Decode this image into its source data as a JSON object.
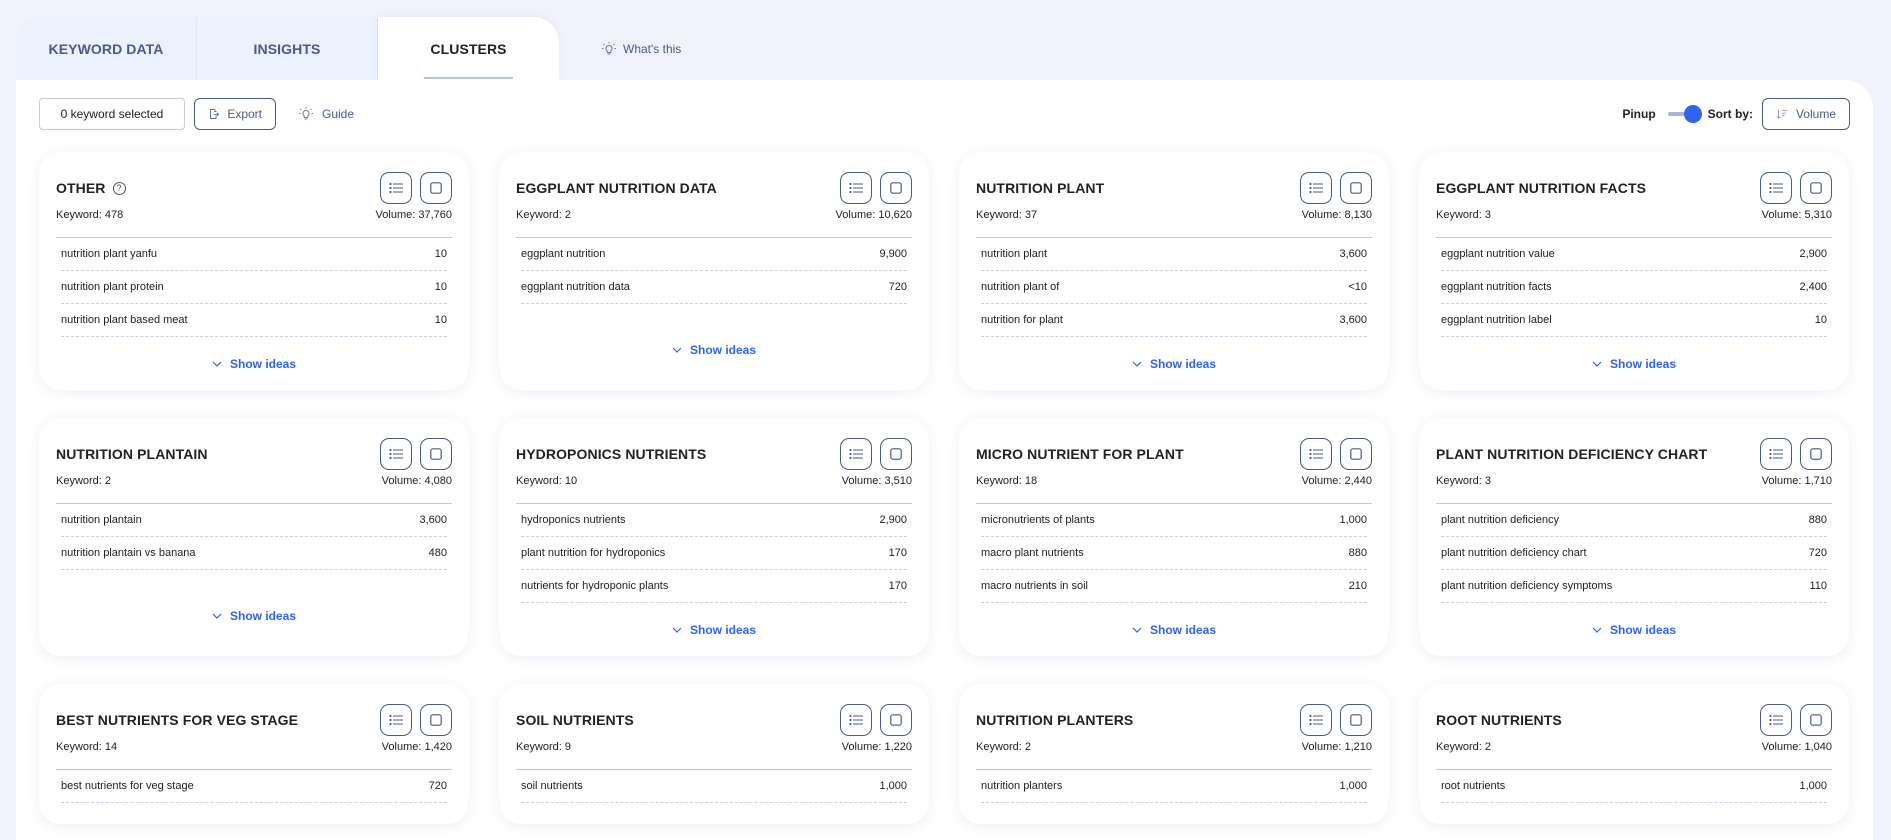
{
  "tabs": [
    {
      "label": "KEYWORD DATA",
      "active": false
    },
    {
      "label": "INSIGHTS",
      "active": false
    },
    {
      "label": "CLUSTERS",
      "active": true
    }
  ],
  "whats_this": {
    "label": "What's this",
    "icon": "lightbulb-icon"
  },
  "toolbar": {
    "selected_label": "0 keyword selected",
    "export_label": "Export",
    "guide_label": "Guide",
    "pinup_label": "Pinup",
    "pinup_on": true,
    "sortby_label": "Sort by:",
    "sort_value": "Volume"
  },
  "colors": {
    "accent": "#2f64f0",
    "outline": "#4a5a8c",
    "background": "#f1f2fc"
  },
  "clusters": [
    {
      "title": "OTHER",
      "has_help": true,
      "keyword_label": "Keyword: 478",
      "volume_label": "Volume: 37,760",
      "rows": [
        {
          "keyword": "nutrition plant yanfu",
          "volume": "10"
        },
        {
          "keyword": "nutrition plant protein",
          "volume": "10"
        },
        {
          "keyword": "nutrition plant based meat",
          "volume": "10"
        }
      ],
      "show_ideas": "Show ideas"
    },
    {
      "title": "EGGPLANT NUTRITION DATA",
      "keyword_label": "Keyword: 2",
      "volume_label": "Volume: 10,620",
      "rows": [
        {
          "keyword": "eggplant nutrition",
          "volume": "9,900"
        },
        {
          "keyword": "eggplant nutrition data",
          "volume": "720"
        }
      ],
      "show_ideas": "Show ideas"
    },
    {
      "title": "NUTRITION PLANT",
      "keyword_label": "Keyword: 37",
      "volume_label": "Volume: 8,130",
      "rows": [
        {
          "keyword": "nutrition plant",
          "volume": "3,600"
        },
        {
          "keyword": "nutrition plant of",
          "volume": "<10"
        },
        {
          "keyword": "nutrition for plant",
          "volume": "3,600"
        }
      ],
      "show_ideas": "Show ideas"
    },
    {
      "title": "EGGPLANT NUTRITION FACTS",
      "keyword_label": "Keyword: 3",
      "volume_label": "Volume: 5,310",
      "rows": [
        {
          "keyword": "eggplant nutrition value",
          "volume": "2,900"
        },
        {
          "keyword": "eggplant nutrition facts",
          "volume": "2,400"
        },
        {
          "keyword": "eggplant nutrition label",
          "volume": "10"
        }
      ],
      "show_ideas": "Show ideas"
    },
    {
      "title": "NUTRITION PLANTAIN",
      "keyword_label": "Keyword: 2",
      "volume_label": "Volume: 4,080",
      "rows": [
        {
          "keyword": "nutrition plantain",
          "volume": "3,600"
        },
        {
          "keyword": "nutrition plantain vs banana",
          "volume": "480"
        }
      ],
      "show_ideas": "Show ideas"
    },
    {
      "title": "HYDROPONICS NUTRIENTS",
      "keyword_label": "Keyword: 10",
      "volume_label": "Volume: 3,510",
      "rows": [
        {
          "keyword": "hydroponics nutrients",
          "volume": "2,900"
        },
        {
          "keyword": "plant nutrition for hydroponics",
          "volume": "170"
        },
        {
          "keyword": "nutrients for hydroponic plants",
          "volume": "170"
        }
      ],
      "show_ideas": "Show ideas"
    },
    {
      "title": "MICRO NUTRIENT FOR PLANT",
      "keyword_label": "Keyword: 18",
      "volume_label": "Volume: 2,440",
      "rows": [
        {
          "keyword": "micronutrients of plants",
          "volume": "1,000"
        },
        {
          "keyword": "macro plant nutrients",
          "volume": "880"
        },
        {
          "keyword": "macro nutrients in soil",
          "volume": "210"
        }
      ],
      "show_ideas": "Show ideas"
    },
    {
      "title": "PLANT NUTRITION DEFICIENCY CHART",
      "keyword_label": "Keyword: 3",
      "volume_label": "Volume: 1,710",
      "rows": [
        {
          "keyword": "plant nutrition deficiency",
          "volume": "880"
        },
        {
          "keyword": "plant nutrition deficiency chart",
          "volume": "720"
        },
        {
          "keyword": "plant nutrition deficiency symptoms",
          "volume": "110"
        }
      ],
      "show_ideas": "Show ideas"
    },
    {
      "title": "BEST NUTRIENTS FOR VEG STAGE",
      "keyword_label": "Keyword: 14",
      "volume_label": "Volume: 1,420",
      "rows": [
        {
          "keyword": "best nutrients for veg stage",
          "volume": "720"
        }
      ]
    },
    {
      "title": "SOIL NUTRIENTS",
      "keyword_label": "Keyword: 9",
      "volume_label": "Volume: 1,220",
      "rows": [
        {
          "keyword": "soil nutrients",
          "volume": "1,000"
        }
      ]
    },
    {
      "title": "NUTRITION PLANTERS",
      "keyword_label": "Keyword: 2",
      "volume_label": "Volume: 1,210",
      "rows": [
        {
          "keyword": "nutrition planters",
          "volume": "1,000"
        }
      ]
    },
    {
      "title": "ROOT NUTRIENTS",
      "keyword_label": "Keyword: 2",
      "volume_label": "Volume: 1,040",
      "rows": [
        {
          "keyword": "root nutrients",
          "volume": "1,000"
        }
      ]
    }
  ]
}
